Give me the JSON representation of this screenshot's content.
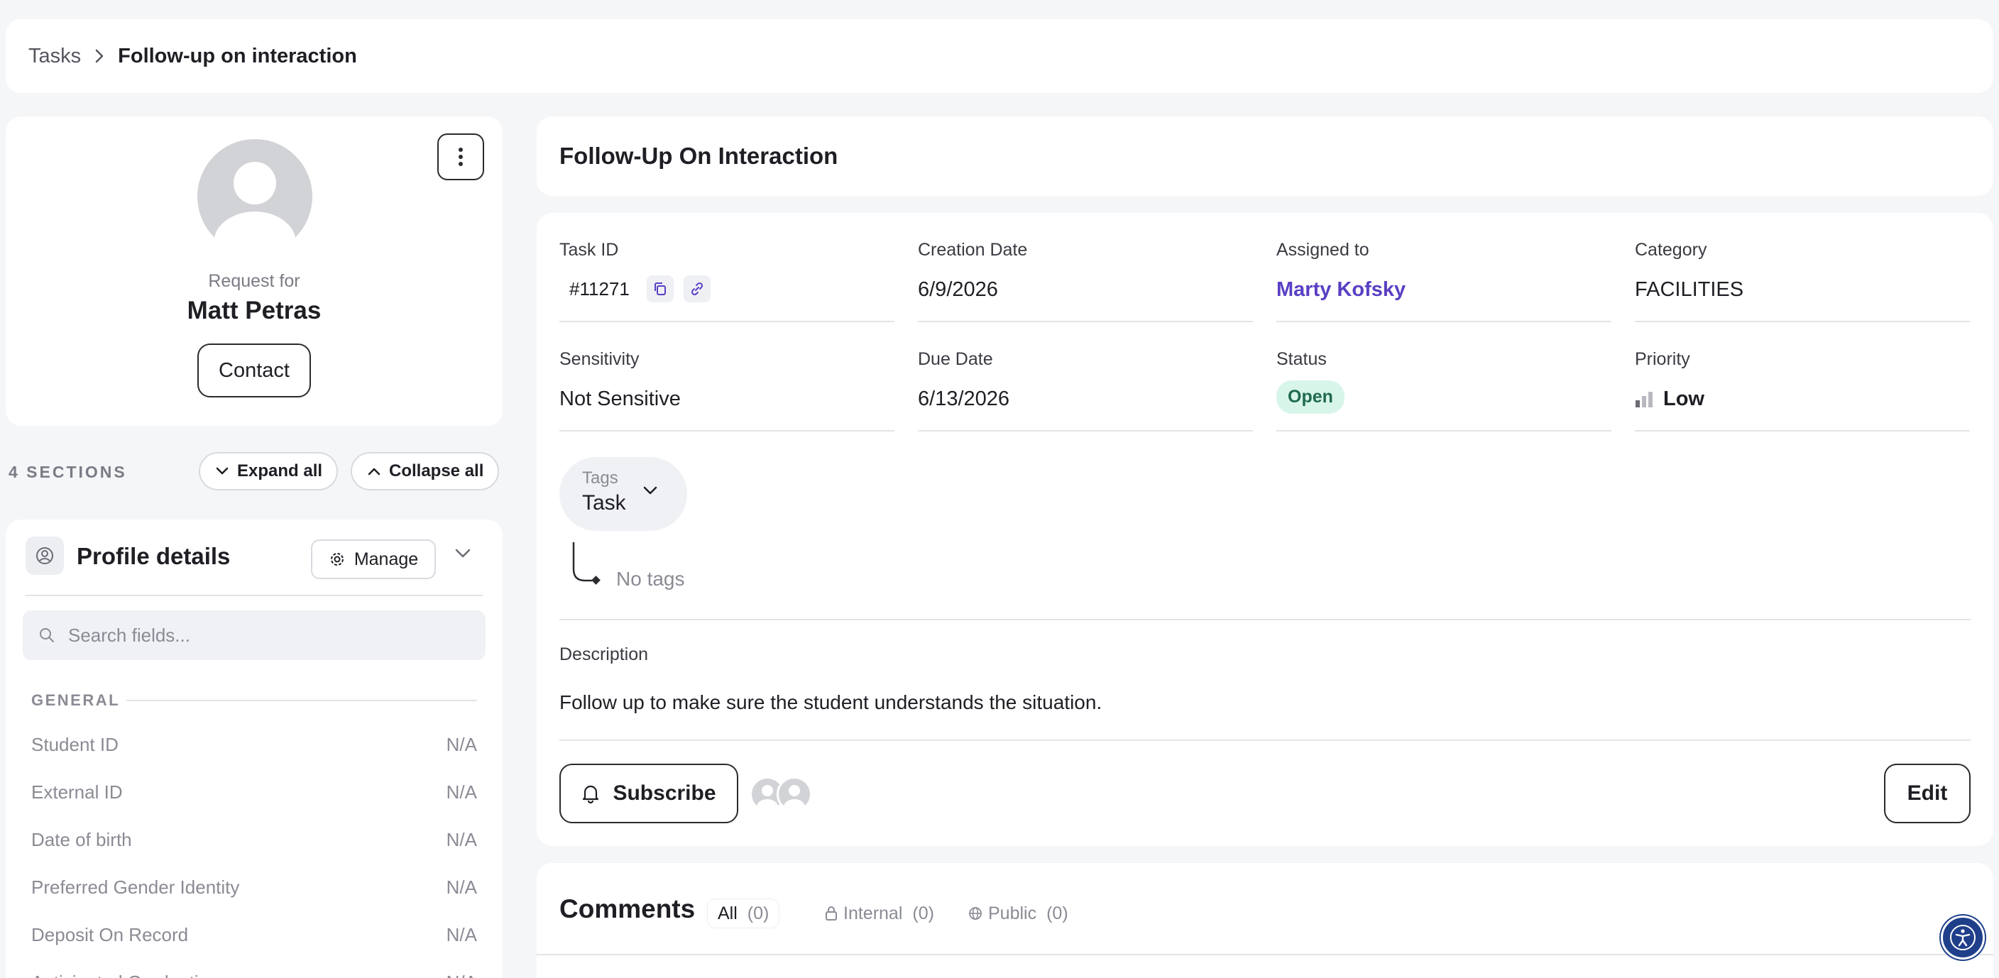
{
  "breadcrumb": {
    "root": "Tasks",
    "current": "Follow-up on interaction"
  },
  "request": {
    "for_label": "Request for",
    "name": "Matt Petras",
    "contact_label": "Contact"
  },
  "sections": {
    "count_label": "4 SECTIONS",
    "expand_label": "Expand all",
    "collapse_label": "Collapse all"
  },
  "profile": {
    "title": "Profile details",
    "manage_label": "Manage",
    "search_placeholder": "Search fields...",
    "group_label": "GENERAL",
    "fields": [
      {
        "label": "Student ID",
        "value": "N/A"
      },
      {
        "label": "External ID",
        "value": "N/A"
      },
      {
        "label": "Date of birth",
        "value": "N/A"
      },
      {
        "label": "Preferred Gender Identity",
        "value": "N/A"
      },
      {
        "label": "Deposit On Record",
        "value": "N/A"
      },
      {
        "label": "Anticipated Graduation",
        "value": "N/A"
      }
    ]
  },
  "task": {
    "title": "Follow-Up On Interaction",
    "task_id_label": "Task ID",
    "task_id": "#11271",
    "creation_date_label": "Creation Date",
    "creation_date": "6/9/2026",
    "assigned_label": "Assigned to",
    "assigned_to": "Marty Kofsky",
    "category_label": "Category",
    "category": "FACILITIES",
    "sensitivity_label": "Sensitivity",
    "sensitivity": "Not Sensitive",
    "due_date_label": "Due Date",
    "due_date": "6/13/2026",
    "status_label": "Status",
    "status": "Open",
    "priority_label": "Priority",
    "priority": "Low",
    "tags_label": "Tags",
    "tags_value": "Task",
    "no_tags": "No tags",
    "description_label": "Description",
    "description": "Follow up to make sure the student understands the situation.",
    "subscribe_label": "Subscribe",
    "edit_label": "Edit"
  },
  "comments": {
    "title": "Comments",
    "tabs": [
      {
        "label": "All",
        "count": "(0)"
      },
      {
        "label": "Internal",
        "count": "(0)"
      },
      {
        "label": "Public",
        "count": "(0)"
      }
    ]
  },
  "colors": {
    "accent": "#5a3fc4",
    "status_bg": "#d8f5ea",
    "status_fg": "#1f6a4e",
    "a11y": "#1f3f8a"
  },
  "icons": [
    "chevron-right-icon",
    "kebab-icon",
    "chevron-down-icon",
    "chevron-up-icon",
    "user-circle-icon",
    "gear-icon",
    "search-icon",
    "copy-icon",
    "link-icon",
    "priority-bars-icon",
    "bell-icon",
    "lock-icon",
    "globe-icon",
    "accessibility-icon"
  ]
}
